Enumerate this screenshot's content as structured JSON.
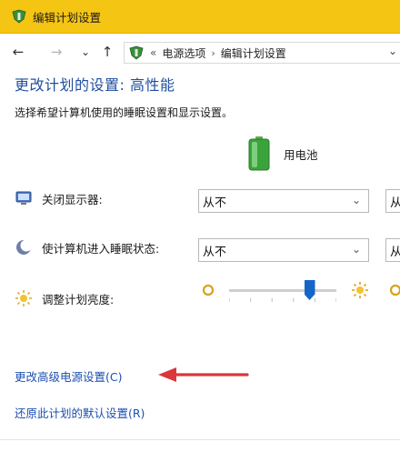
{
  "window": {
    "title": "编辑计划设置"
  },
  "nav": {
    "back": "←",
    "forward": "→",
    "recent": "⌄",
    "up": "↑",
    "breadcrumb_prefix": "«",
    "breadcrumb": [
      "电源选项",
      "编辑计划设置"
    ],
    "breadcrumb_sep": "›",
    "dropdown": "⌄"
  },
  "main": {
    "title": "更改计划的设置: 高性能",
    "subtitle": "选择希望计算机使用的睡眠设置和显示设置。",
    "column_header": "用电池",
    "rows": [
      {
        "label": "关闭显示器:",
        "value": "从不",
        "value2": "从"
      },
      {
        "label": "使计算机进入睡眠状态:",
        "value": "从不",
        "value2": "从"
      },
      {
        "label": "调整计划亮度:"
      }
    ],
    "brightness_level": 0.75
  },
  "links": {
    "advanced": "更改高级电源设置(C)",
    "restore": "还原此计划的默认设置(R)"
  },
  "colors": {
    "titlebar": "#f5c514",
    "link": "#1c4fb0",
    "title": "#1f4fa0",
    "slider": "#1565c8",
    "arrow": "#d9363e"
  }
}
